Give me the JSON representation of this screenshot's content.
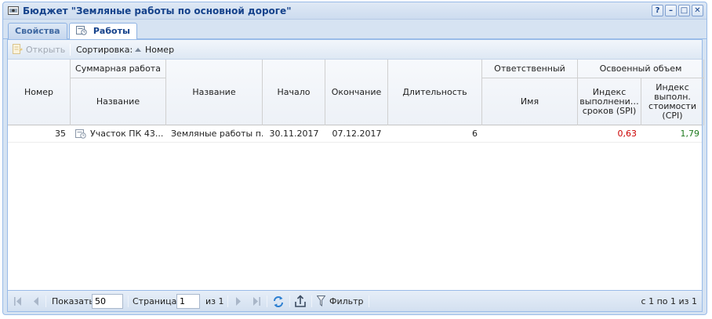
{
  "window": {
    "title": "Бюджет \"Земляные работы по основной дороге\"",
    "tools": [
      "?",
      "–",
      "□",
      "✕"
    ]
  },
  "tabs": [
    {
      "label": "Свойства",
      "active": false
    },
    {
      "label": "Работы",
      "active": true
    }
  ],
  "toolbar": {
    "open_label": "Открыть",
    "sort_label": "Сортировка:",
    "sort_field": "Номер"
  },
  "columns": {
    "number": "Номер",
    "summary_group": "Суммарная работа",
    "summary_name": "Название",
    "name": "Название",
    "start": "Начало",
    "end": "Окончание",
    "duration": "Длительность",
    "responsible_group": "Ответственный",
    "responsible_name": "Имя",
    "earned_group": "Освоенный объем",
    "spi": "Индекс выполнени… сроков (SPI)",
    "cpi": "Индекс выполн. стоимости (CPI)"
  },
  "rows": [
    {
      "number": "35",
      "summary_name": "Участок ПК 43...",
      "name": "Земляные работы п...",
      "start": "30.11.2017",
      "end": "07.12.2017",
      "duration": "6",
      "responsible": "",
      "spi": "0,63",
      "cpi": "1,79"
    }
  ],
  "pager": {
    "show_label": "Показать",
    "page_size": "50",
    "page_label": "Страница",
    "page_value": "1",
    "of_label": "из 1",
    "filter_label": "Фильтр",
    "summary": "с 1 по 1 из 1"
  },
  "colors": {
    "spi": "#cc0000",
    "cpi": "#1e7a1e",
    "title": "#15428b"
  }
}
